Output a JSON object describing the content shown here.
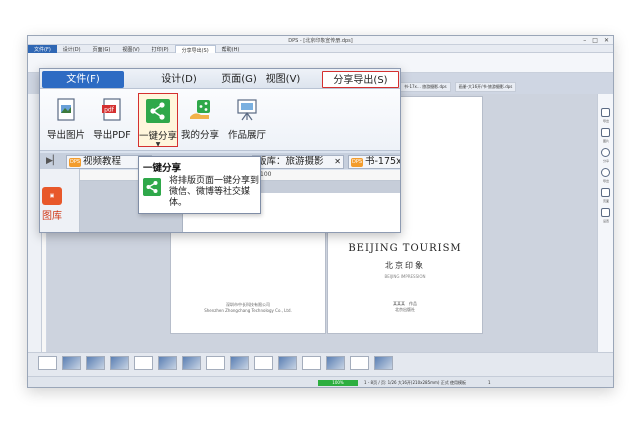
{
  "app": {
    "title": "DPS - [北京印象宣传册.dps]",
    "menubar": [
      "文件(F)",
      "设计(D)",
      "页面(G)",
      "视图(V)",
      "打印(P)",
      "分享导出(S)",
      "帮助(H)"
    ],
    "doc_tabs": [
      "书-17x… 旅游摄影.dps",
      "画册-大16开/书-旅游摄影.dps",
      "…北京印象.dps"
    ],
    "page_left_publisher": [
      "深圳市中长科技有限公司",
      "Shenzhen Zhongchang Technology Co., Ltd."
    ],
    "book_title_en": "BEIJING TOURISM",
    "book_title_cn": "北京印象",
    "book_subtitle": "BEIJING IMPRESSION",
    "book_author": [
      "某某某　作品",
      "北京出版社"
    ],
    "right_panel": [
      "导出",
      "图片",
      "分享",
      "导出",
      "页面",
      "设置"
    ],
    "status_zoom": "100%",
    "status_text": "1 - 8页 / 页: 1/26  大16开(210x285mm) 正式 使用模板",
    "status_page": "1"
  },
  "ribbon": {
    "tabs": {
      "file": "文件(F)",
      "design": "设计(D)",
      "page": "页面(G)",
      "view": "视图(V)",
      "print": "印刷(P)",
      "share": "分享导出(S)"
    },
    "buttons": {
      "export_image": "导出图片",
      "export_pdf": "导出PDF",
      "one_click_share": "一键分享",
      "my_share": "我的分享",
      "gallery": "作品展厅"
    },
    "doctabs": {
      "tab1": "视频教程",
      "tab2": "版库：旅游摄影",
      "tab3": "书-175x"
    },
    "left_lib": "图库",
    "ruler_mark": "100"
  },
  "tooltip": {
    "title": "一键分享",
    "text": "将排版页面一键分享到微信、微博等社交媒体。"
  },
  "colors": {
    "file_tab": "#2d6bc3",
    "highlight_red": "#d43030",
    "share_green": "#2fa84a",
    "status_green": "#2cae3f"
  }
}
